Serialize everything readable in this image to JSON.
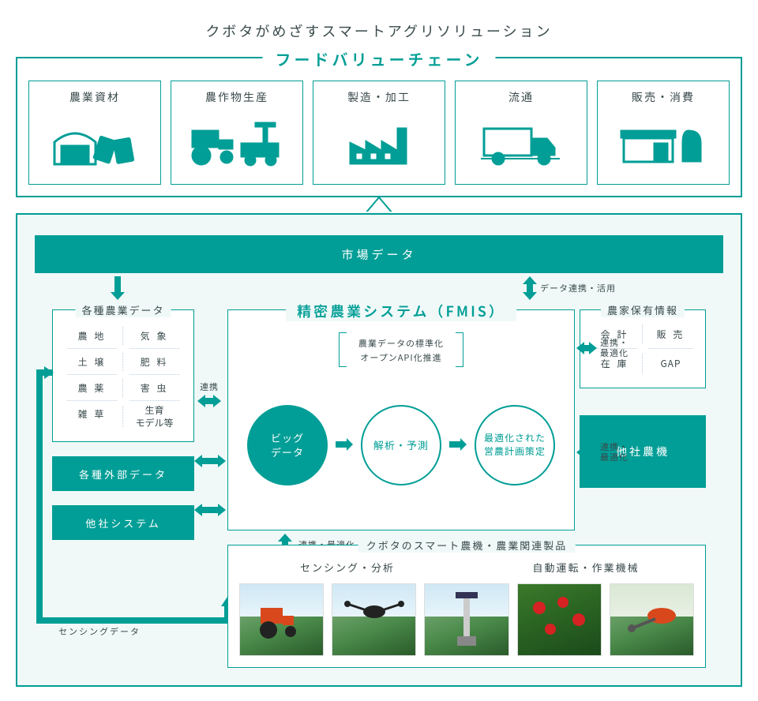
{
  "title": "クボタがめざすスマートアグリソリューション",
  "food_chain": {
    "title": "フードバリューチェーン",
    "cards": [
      {
        "label": "農業資材",
        "icon": "materials"
      },
      {
        "label": "農作物生産",
        "icon": "production"
      },
      {
        "label": "製造・加工",
        "icon": "factory"
      },
      {
        "label": "流通",
        "icon": "truck"
      },
      {
        "label": "販売・消費",
        "icon": "retail"
      }
    ]
  },
  "market_bar": "市場データ",
  "arrow_labels": {
    "data_link": "データ連携・活用",
    "link_opt": "連携・\n最適化",
    "link": "連携",
    "link_opt_h": "連携・最適化",
    "sensing": "センシングデータ"
  },
  "agri_data": {
    "title": "各種農業データ",
    "cells": [
      "農 地",
      "気 象",
      "土 壌",
      "肥 料",
      "農 薬",
      "害 虫",
      "雑 草",
      "生育\nモデル等"
    ]
  },
  "external_data": "各種外部データ",
  "other_system": "他社システム",
  "fmis": {
    "title": "精密農業システム（FMIS）",
    "note_lines": [
      "農業データの標準化",
      "オープンAPI化推進"
    ],
    "circles": [
      "ビッグ\nデータ",
      "解析・予測",
      "最適化された\n営農計画策定"
    ]
  },
  "farmer_info": {
    "title": "農家保有情報",
    "cells": [
      "会 計",
      "販 売",
      "在 庫",
      "GAP"
    ]
  },
  "other_mach": "他社農機",
  "kubota_products": {
    "title": "クボタのスマート農機・農業関連製品",
    "sub": [
      "センシング・分析",
      "自動運転・作業機械"
    ],
    "images": [
      "tractor",
      "drone",
      "sensor",
      "crops",
      "sprayer"
    ]
  }
}
